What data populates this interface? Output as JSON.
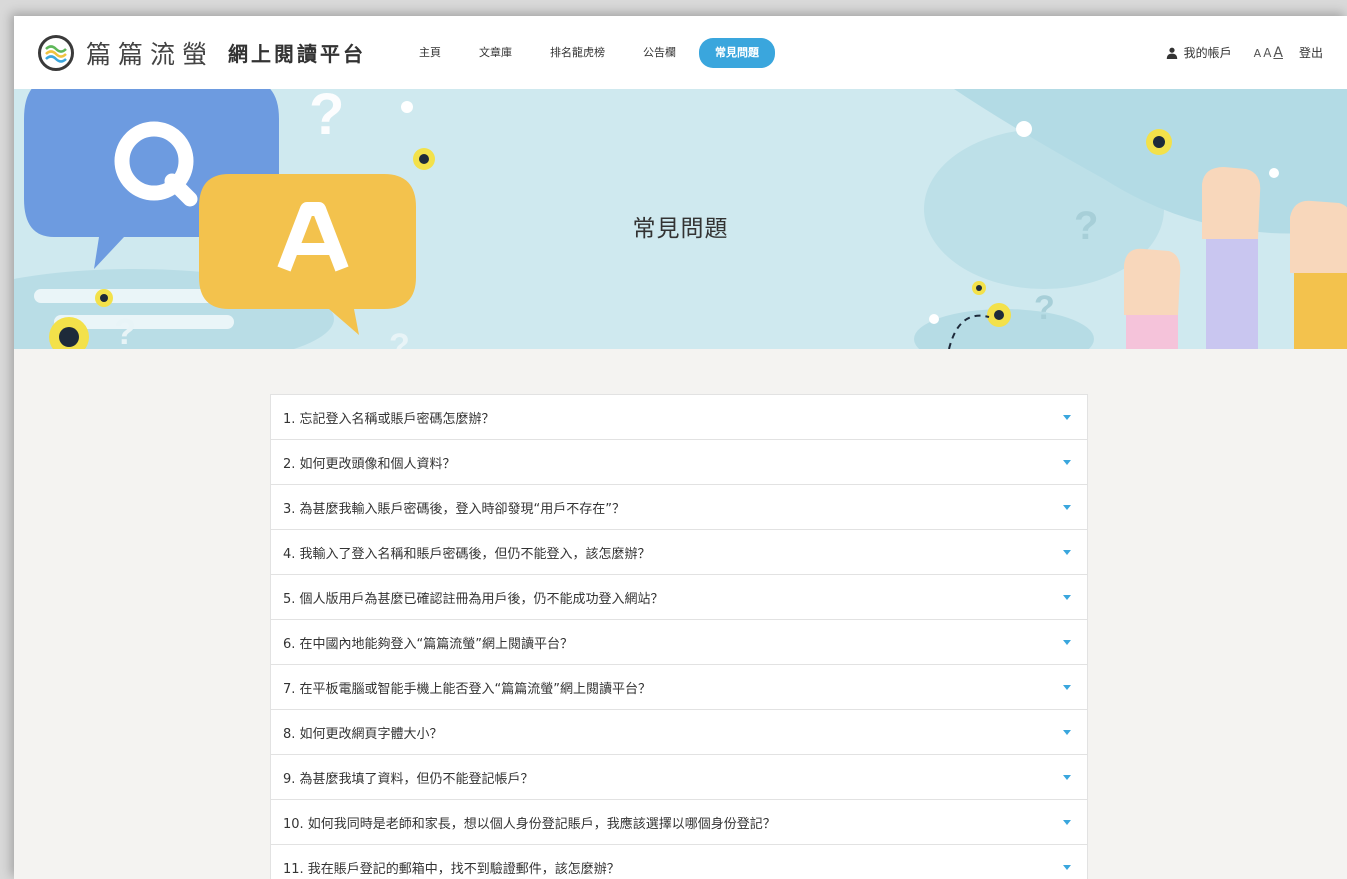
{
  "brand": {
    "name": "篇篇流螢",
    "subtitle": "網上閱讀平台"
  },
  "menu": [
    {
      "label": "主頁",
      "active": false
    },
    {
      "label": "文章庫",
      "active": false
    },
    {
      "label": "排名龍虎榜",
      "active": false
    },
    {
      "label": "公告欄",
      "active": false
    },
    {
      "label": "常見問題",
      "active": true
    }
  ],
  "account": {
    "label": "我的帳戶",
    "icon": "user-icon",
    "font_sizes": [
      "A",
      "A",
      "A"
    ],
    "logout": "登出"
  },
  "hero": {
    "title": "常見問題",
    "q_letter": "Q",
    "a_letter": "A"
  },
  "faq": [
    "1. 忘記登入名稱或賬戶密碼怎麼辦？",
    "2. 如何更改頭像和個人資料？",
    "3. 為甚麼我輸入賬戶密碼後，登入時卻發現“用戶不存在”？",
    "4. 我輸入了登入名稱和賬戶密碼後，但仍不能登入，該怎麼辦？",
    "5. 個人版用戶為甚麼已確認註冊為用戶後，仍不能成功登入網站？",
    "6. 在中國內地能夠登入“篇篇流螢”網上閱讀平台？",
    "7. 在平板電腦或智能手機上能否登入“篇篇流螢”網上閱讀平台？",
    "8. 如何更改網頁字體大小？",
    "9. 為甚麼我填了資料，但仍不能登記帳戶？",
    "10. 如何我同時是老師和家長，想以個人身份登記賬戶，我應該選擇以哪個身份登記？",
    "11. 我在賬戶登記的郵箱中，找不到驗證郵件，該怎麼辦？"
  ],
  "colors": {
    "accent": "#3aa6dd",
    "hero_bg": "#cfe9ef",
    "q_bubble": "#6d9be0",
    "a_bubble": "#f3c24d"
  }
}
